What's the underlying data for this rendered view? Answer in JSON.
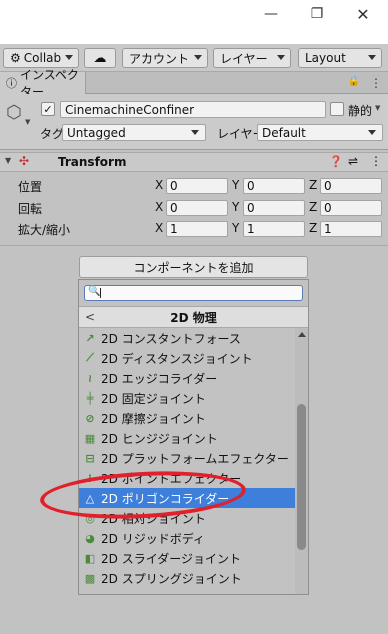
{
  "window": {
    "minimize_glyph": "—",
    "maximize_glyph": "❐",
    "close_glyph": "✕"
  },
  "toolbar": {
    "collab_label": "Collab",
    "account_label": "アカウント",
    "layers_label": "レイヤー",
    "layout_label": "Layout"
  },
  "inspector_tab": {
    "label": "インスペクター",
    "lock_glyph": "🔒",
    "menu_glyph": "⋮"
  },
  "object": {
    "name": "CinemachineConfiner",
    "static_label": "静的",
    "tag_label": "タグ",
    "tag_value": "Untagged",
    "layer_label": "レイヤー",
    "layer_value": "Default"
  },
  "transform": {
    "title": "Transform",
    "rows": [
      {
        "label": "位置",
        "x": "0",
        "y": "0",
        "z": "0"
      },
      {
        "label": "回転",
        "x": "0",
        "y": "0",
        "z": "0"
      },
      {
        "label": "拡大/縮小",
        "x": "1",
        "y": "1",
        "z": "1"
      }
    ],
    "axis_x": "X",
    "axis_y": "Y",
    "axis_z": "Z"
  },
  "add_component": {
    "button_label": "コンポーネントを追加",
    "category_title": "2D 物理",
    "back_glyph": "<",
    "items": [
      {
        "label": "2D コンスタントフォース",
        "icon": "constant-force-icon"
      },
      {
        "label": "2D ディスタンスジョイント",
        "icon": "distance-joint-icon"
      },
      {
        "label": "2D エッジコライダー",
        "icon": "edge-collider-icon"
      },
      {
        "label": "2D 固定ジョイント",
        "icon": "fixed-joint-icon"
      },
      {
        "label": "2D 摩擦ジョイント",
        "icon": "friction-joint-icon"
      },
      {
        "label": "2D ヒンジジョイント",
        "icon": "hinge-joint-icon"
      },
      {
        "label": "2D プラットフォームエフェクター",
        "icon": "platform-effector-icon"
      },
      {
        "label": "2D ポイントエフェクター",
        "icon": "point-effector-icon"
      },
      {
        "label": "2D ポリゴンコライダー",
        "icon": "polygon-collider-icon",
        "selected": true
      },
      {
        "label": "2D 相対ジョイント",
        "icon": "relative-joint-icon"
      },
      {
        "label": "2D リジッドボディ",
        "icon": "rigidbody-icon"
      },
      {
        "label": "2D スライダージョイント",
        "icon": "slider-joint-icon"
      },
      {
        "label": "2D スプリングジョイント",
        "icon": "spring-joint-icon"
      }
    ]
  },
  "colors": {
    "selection": "#3d7fdb",
    "annotation_ring": "#e0202a",
    "panel_bg": "#c2c2c2"
  }
}
